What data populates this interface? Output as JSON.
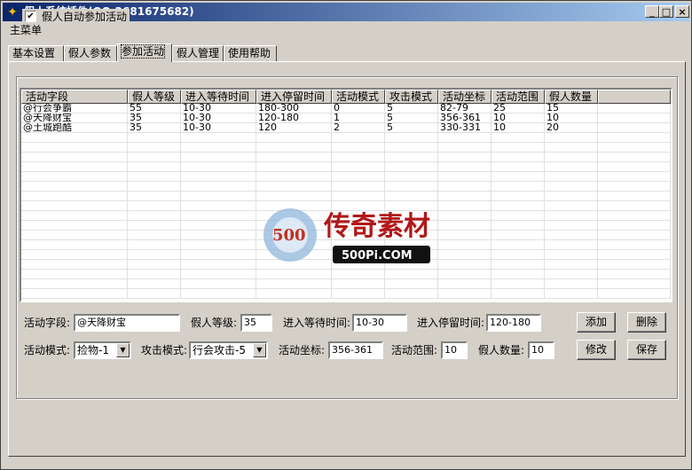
{
  "window": {
    "title": "假人系统插件(QQ:2681675682)",
    "minimize": "0",
    "maximize": "1",
    "close": "r"
  },
  "menubar": {
    "main_menu": "主菜单"
  },
  "tabs": [
    "基本设置",
    "假人参数",
    "参加活动",
    "假人管理",
    "使用帮助"
  ],
  "active_tab": "参加活动",
  "auto_join": {
    "label": "假人自动参加活动",
    "checked": true
  },
  "table": {
    "columns": [
      "活动字段",
      "假人等级",
      "进入等待时间",
      "进入停留时间",
      "活动模式",
      "攻击模式",
      "活动坐标",
      "活动范围",
      "假人数量"
    ],
    "rows": [
      [
        "@行会争霸",
        "55",
        "10-30",
        "180-300",
        "0",
        "5",
        "82-79",
        "25",
        "15"
      ],
      [
        "@天降财宝",
        "35",
        "10-30",
        "120-180",
        "1",
        "5",
        "356-361",
        "10",
        "10"
      ],
      [
        "@土城跑酷",
        "35",
        "10-30",
        "120",
        "2",
        "5",
        "330-331",
        "10",
        "20"
      ]
    ]
  },
  "watermark": {
    "text": "传奇素材",
    "sub": "500Pi.COM"
  },
  "form": {
    "field_label": "活动字段:",
    "field_value": "@天降财宝",
    "level_label": "假人等级:",
    "level_value": "35",
    "wait_label": "进入等待时间:",
    "wait_value": "10-30",
    "stay_label": "进入停留时间:",
    "stay_value": "120-180",
    "mode_label": "活动模式:",
    "mode_value": "捡物-1",
    "attack_label": "攻击模式:",
    "attack_value": "行会攻击-5",
    "coord_label": "活动坐标:",
    "coord_value": "356-361",
    "range_label": "活动范围:",
    "range_value": "10",
    "count_label": "假人数量:",
    "count_value": "10"
  },
  "buttons": {
    "add": "添加",
    "delete": "删除",
    "modify": "修改",
    "save": "保存"
  }
}
